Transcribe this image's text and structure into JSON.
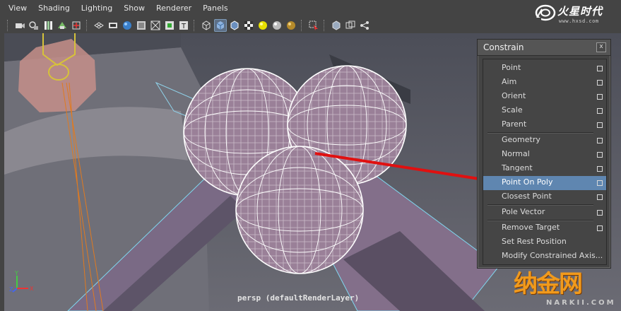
{
  "menubar": {
    "items": [
      "View",
      "Shading",
      "Lighting",
      "Show",
      "Renderer",
      "Panels"
    ]
  },
  "logo": {
    "name": "火星时代",
    "url": "www.hxsd.com"
  },
  "toolbar": {
    "groups": [
      [
        "camera-select-icon",
        "camera-attributes-icon",
        "bookmark-icon",
        "image-plane-icon",
        "two-d-pan-icon"
      ],
      [
        "grid-icon",
        "film-gate-icon",
        "resolution-gate-icon",
        "gate-mask-icon",
        "field-chart-icon",
        "safe-action-icon",
        "safe-title-icon"
      ],
      [
        "wireframe-icon",
        "smooth-shade-icon",
        "wireframe-on-shaded-icon",
        "textured-icon",
        "use-all-lights-icon",
        "shadows-icon",
        "high-quality-icon"
      ],
      [
        "isolate-select-icon"
      ],
      [
        "xray-icon",
        "xray-joints-icon",
        "backface-culling-icon"
      ]
    ],
    "active": "smooth-shade-icon"
  },
  "viewport": {
    "camera_label": "persp (defaultRenderLayer)"
  },
  "axis": {
    "x": "X",
    "y": "Y",
    "z": "Z"
  },
  "watermark": {
    "big": "纳金网",
    "small": "NARKII.COM"
  },
  "constrain_panel": {
    "title": "Constrain",
    "close": "x",
    "items": [
      {
        "label": "Point",
        "option_box": true
      },
      {
        "label": "Aim",
        "option_box": true
      },
      {
        "label": "Orient",
        "option_box": true
      },
      {
        "label": "Scale",
        "option_box": true
      },
      {
        "label": "Parent",
        "option_box": true
      },
      {
        "label": "Geometry",
        "option_box": true
      },
      {
        "label": "Normal",
        "option_box": true
      },
      {
        "label": "Tangent",
        "option_box": true
      },
      {
        "label": "Point On Poly",
        "option_box": true,
        "highlighted": true
      },
      {
        "label": "Closest Point",
        "option_box": true
      },
      {
        "label": "Pole Vector",
        "option_box": true
      },
      {
        "label": "Remove Target",
        "option_box": true
      },
      {
        "label": "Set Rest Position",
        "option_box": false
      },
      {
        "label": "Modify Constrained Axis...",
        "option_box": false
      }
    ]
  },
  "colors": {
    "highlight": "#5f86b0",
    "annotation_arrow": "#e01010",
    "wire": "#ffffff",
    "sphere_fill": "#9a8098"
  }
}
